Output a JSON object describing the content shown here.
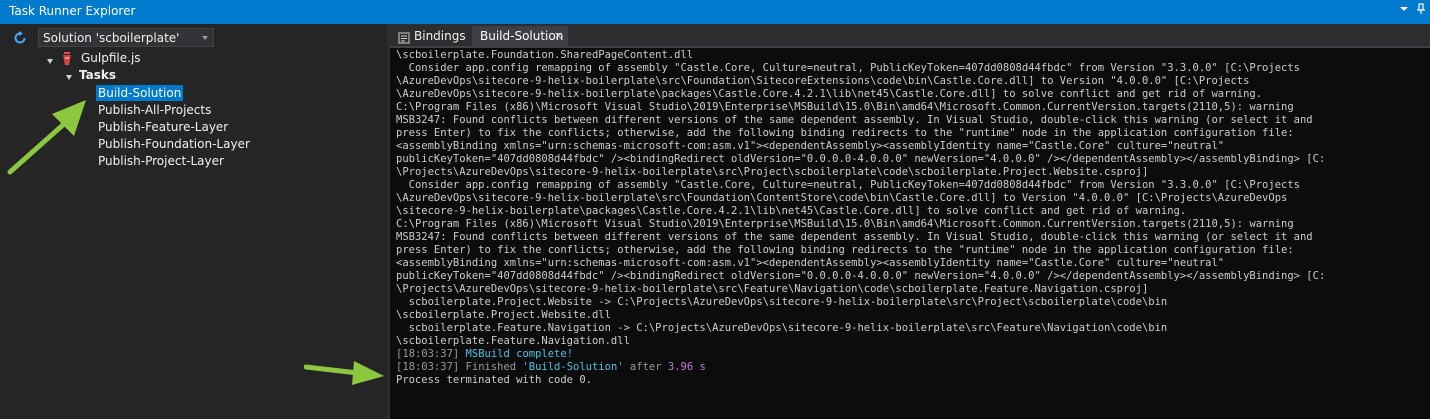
{
  "window": {
    "title": "Task Runner Explorer",
    "pin_icon": "pin-icon",
    "dropdown_icon": "dropdown-icon"
  },
  "toolbar": {
    "refresh_icon": "refresh-icon",
    "solution_selector": "Solution 'scboilerplate'"
  },
  "tree": {
    "gulpfile": "Gulpfile.js",
    "tasks_label": "Tasks",
    "tasks": [
      "Build-Solution",
      "Publish-All-Projects",
      "Publish-Feature-Layer",
      "Publish-Foundation-Layer",
      "Publish-Project-Layer"
    ],
    "selected": "Build-Solution"
  },
  "tabs": {
    "bindings": "Bindings",
    "active": "Build-Solution",
    "close": "×"
  },
  "console": {
    "lines": [
      "\\scboilerplate.Foundation.SharedPageContent.dll",
      "  Consider app.config remapping of assembly \"Castle.Core, Culture=neutral, PublicKeyToken=407dd0808d44fbdc\" from Version \"3.3.0.0\" [C:\\Projects",
      "\\AzureDevOps\\sitecore-9-helix-boilerplate\\src\\Foundation\\SitecoreExtensions\\code\\bin\\Castle.Core.dll] to Version \"4.0.0.0\" [C:\\Projects",
      "\\AzureDevOps\\sitecore-9-helix-boilerplate\\packages\\Castle.Core.4.2.1\\lib\\net45\\Castle.Core.dll] to solve conflict and get rid of warning.",
      "C:\\Program Files (x86)\\Microsoft Visual Studio\\2019\\Enterprise\\MSBuild\\15.0\\Bin\\amd64\\Microsoft.Common.CurrentVersion.targets(2110,5): warning",
      "MSB3247: Found conflicts between different versions of the same dependent assembly. In Visual Studio, double-click this warning (or select it and",
      "press Enter) to fix the conflicts; otherwise, add the following binding redirects to the \"runtime\" node in the application configuration file:",
      "<assemblyBinding xmlns=\"urn:schemas-microsoft-com:asm.v1\"><dependentAssembly><assemblyIdentity name=\"Castle.Core\" culture=\"neutral\"",
      "publicKeyToken=\"407dd0808d44fbdc\" /><bindingRedirect oldVersion=\"0.0.0.0-4.0.0.0\" newVersion=\"4.0.0.0\" /></dependentAssembly></assemblyBinding> [C:",
      "\\Projects\\AzureDevOps\\sitecore-9-helix-boilerplate\\src\\Project\\scboilerplate\\code\\scboilerplate.Project.Website.csproj]",
      "  Consider app.config remapping of assembly \"Castle.Core, Culture=neutral, PublicKeyToken=407dd0808d44fbdc\" from Version \"3.3.0.0\" [C:\\Projects",
      "\\AzureDevOps\\sitecore-9-helix-boilerplate\\src\\Foundation\\ContentStore\\code\\bin\\Castle.Core.dll] to Version \"4.0.0.0\" [C:\\Projects\\AzureDevOps",
      "\\sitecore-9-helix-boilerplate\\packages\\Castle.Core.4.2.1\\lib\\net45\\Castle.Core.dll] to solve conflict and get rid of warning.",
      "C:\\Program Files (x86)\\Microsoft Visual Studio\\2019\\Enterprise\\MSBuild\\15.0\\Bin\\amd64\\Microsoft.Common.CurrentVersion.targets(2110,5): warning",
      "MSB3247: Found conflicts between different versions of the same dependent assembly. In Visual Studio, double-click this warning (or select it and",
      "press Enter) to fix the conflicts; otherwise, add the following binding redirects to the \"runtime\" node in the application configuration file:",
      "<assemblyBinding xmlns=\"urn:schemas-microsoft-com:asm.v1\"><dependentAssembly><assemblyIdentity name=\"Castle.Core\" culture=\"neutral\"",
      "publicKeyToken=\"407dd0808d44fbdc\" /><bindingRedirect oldVersion=\"0.0.0.0-4.0.0.0\" newVersion=\"4.0.0.0\" /></dependentAssembly></assemblyBinding> [C:",
      "\\Projects\\AzureDevOps\\sitecore-9-helix-boilerplate\\src\\Feature\\Navigation\\code\\scboilerplate.Feature.Navigation.csproj]",
      "  scboilerplate.Project.Website -> C:\\Projects\\AzureDevOps\\sitecore-9-helix-boilerplate\\src\\Project\\scboilerplate\\code\\bin",
      "\\scboilerplate.Project.Website.dll",
      "  scboilerplate.Feature.Navigation -> C:\\Projects\\AzureDevOps\\sitecore-9-helix-boilerplate\\src\\Feature\\Navigation\\code\\bin",
      "\\scboilerplate.Feature.Navigation.dll"
    ],
    "status": {
      "ts1": "[18:03:37] ",
      "msg1": "MSBuild complete!",
      "ts2": "[18:03:37] ",
      "finished": "Finished ",
      "task": "'Build-Solution'",
      "after": " after ",
      "duration": "3.96 s",
      "terminated": "Process terminated with code 0."
    }
  },
  "colors": {
    "accent": "#007acc",
    "arrow": "#8dc63f",
    "timestamp": "#9a9a9a",
    "cyan": "#4fc1e9",
    "magenta": "#c678dd"
  }
}
